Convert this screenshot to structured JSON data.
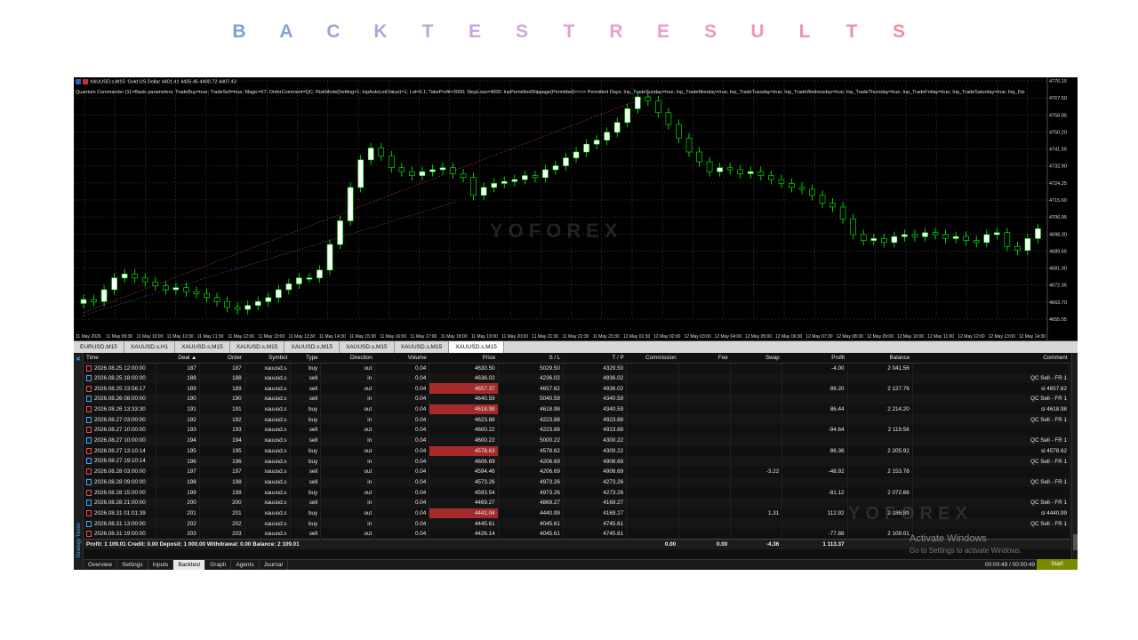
{
  "title_letters": [
    "B",
    "A",
    "C",
    "K",
    "T",
    "E",
    "S",
    "T",
    "R",
    "E",
    "S",
    "U",
    "L",
    "T",
    "S"
  ],
  "title_colors": [
    "#7f9fd8",
    "#8aa3da",
    "#98a6dc",
    "#a7a9de",
    "#b6a9dd",
    "#c4a8dc",
    "#d1a6da",
    "#dca4d6",
    "#e4a1cf",
    "#e99dc6",
    "#ec99bd",
    "#ee96b4",
    "#ef93ab",
    "#ef90a3",
    "#ef8d9b"
  ],
  "chart": {
    "header": "XAUUSD.s,M15:  Gold US Dollar  4401.41 4405.45 4400.72 4407.43",
    "params": "Quantum Commander [11=Basic parameters; TradeBuy=true; TradeSell=true; Magic=67; OrderComment=QC; RiskMode[Setting=1; InpAutoLot(Value)=1; Lot=0.1; TakeProfit=3000; StopLoss=4000; InpPermittedSlippage(Permitted)=>>> Permitted Days; Inp_TradeSunday=true; Inp_TradeMonday=true; Inp_TradeTuesday=true; Inp_TradeWednesday=true; Inp_TradeThursday=true; Inp_TradeFriday=true; Inp_TradeSaturday=true; Inp_Dis",
    "watermark": "YOFOREX",
    "price_labels": [
      "4776.15",
      "4767.50",
      "4758.85",
      "4750.20",
      "4741.55",
      "4732.90",
      "4724.25",
      "4715.60",
      "4706.95",
      "4698.30",
      "4689.65",
      "4681.00",
      "4672.35",
      "4663.70",
      "4655.05"
    ],
    "time_labels": [
      "11 May 2026",
      "11 May 09:30",
      "11 May 10:00",
      "11 May 10:30",
      "11 May 11:30",
      "11 May 12:00",
      "11 May 13:00",
      "11 May 13:30",
      "11 May 14:30",
      "11 May 15:30",
      "11 May 16:00",
      "11 May 17:00",
      "11 May 18:00",
      "11 May 19:00",
      "11 May 20:00",
      "11 May 21:30",
      "11 May 22:30",
      "11 May 23:30",
      "12 May 01:30",
      "12 May 02:00",
      "12 May 03:00",
      "12 May 04:00",
      "12 May 05:00",
      "12 May 06:30",
      "12 May 07:30",
      "12 May 08:30",
      "12 May 09:00",
      "12 May 10:00",
      "12 May 11:00",
      "12 May 12:00",
      "12 May 13:00",
      "12 May 14:30"
    ]
  },
  "symbol_tabs": [
    "EURUSD,M15",
    "XAUUSD.s,H1",
    "XAUUSD.s,M15",
    "XAUUSD.s,M15",
    "XAUUSD.s,M15",
    "XAUUSD.s,M15",
    "XAUUSD.s,M15",
    "XAUUSD.s,M15"
  ],
  "columns": [
    "Time",
    "Deal",
    "Order",
    "Symbol",
    "Type",
    "Direction",
    "Volume",
    "Price",
    "S / L",
    "T / P",
    "Commission",
    "Fee",
    "Swap",
    "Profit",
    "Balance",
    "Comment"
  ],
  "deals": [
    {
      "time": "2026.08.25 12:00:00",
      "deal": "187",
      "order": "187",
      "symbol": "xauusd.s",
      "type": "buy",
      "dir": "out",
      "vol": "0.04",
      "price": "4630.50",
      "sl": "5029.50",
      "tp": "4329.50",
      "swap": "",
      "profit": "-4.00",
      "balance": "2 041.56",
      "comment": "",
      "hl": false
    },
    {
      "time": "2026.08.25 18:00:00",
      "deal": "188",
      "order": "188",
      "symbol": "xauusd.s",
      "type": "sell",
      "dir": "in",
      "vol": "0.04",
      "price": "4636.02",
      "sl": "4236.02",
      "tp": "4936.02",
      "swap": "",
      "profit": "",
      "balance": "",
      "comment": "QC Sell - FR 1",
      "hl": false
    },
    {
      "time": "2026.08.25 23:56:17",
      "deal": "189",
      "order": "189",
      "symbol": "xauusd.s",
      "type": "sell",
      "dir": "out",
      "vol": "0.04",
      "price": "4657.37",
      "sl": "4657.62",
      "tp": "4936.02",
      "swap": "",
      "profit": "86.20",
      "balance": "2 127.76",
      "comment": "sl 4657.62",
      "hl": true
    },
    {
      "time": "2026.08.26 08:00:00",
      "deal": "190",
      "order": "190",
      "symbol": "xauusd.s",
      "type": "sell",
      "dir": "in",
      "vol": "0.04",
      "price": "4640.59",
      "sl": "5040.59",
      "tp": "4340.59",
      "swap": "",
      "profit": "",
      "balance": "",
      "comment": "QC Sell - FR 1",
      "hl": false
    },
    {
      "time": "2026.08.26 13:33:30",
      "deal": "191",
      "order": "191",
      "symbol": "xauusd.s",
      "type": "buy",
      "dir": "out",
      "vol": "0.04",
      "price": "4618.98",
      "sl": "4618.98",
      "tp": "4340.59",
      "swap": "",
      "profit": "86.44",
      "balance": "2 214.20",
      "comment": "sl 4618.98",
      "hl": true
    },
    {
      "time": "2026.08.27 03:00:00",
      "deal": "192",
      "order": "192",
      "symbol": "xauusd.s",
      "type": "buy",
      "dir": "in",
      "vol": "0.04",
      "price": "4623.88",
      "sl": "4223.88",
      "tp": "4923.88",
      "swap": "",
      "profit": "",
      "balance": "",
      "comment": "QC Sell - FR 1",
      "hl": false
    },
    {
      "time": "2026.08.27 10:00:00",
      "deal": "193",
      "order": "193",
      "symbol": "xauusd.s",
      "type": "sell",
      "dir": "out",
      "vol": "0.04",
      "price": "4600.22",
      "sl": "4223.88",
      "tp": "4923.88",
      "swap": "",
      "profit": "-94.64",
      "balance": "2 119.56",
      "comment": "",
      "hl": false
    },
    {
      "time": "2026.08.27 10:00:00",
      "deal": "194",
      "order": "194",
      "symbol": "xauusd.s",
      "type": "sell",
      "dir": "in",
      "vol": "0.04",
      "price": "4600.22",
      "sl": "5000.22",
      "tp": "4300.22",
      "swap": "",
      "profit": "",
      "balance": "",
      "comment": "QC Sell - FR 1",
      "hl": false
    },
    {
      "time": "2026.08.27 13:10:14",
      "deal": "195",
      "order": "195",
      "symbol": "xauusd.s",
      "type": "buy",
      "dir": "out",
      "vol": "0.04",
      "price": "4578.63",
      "sl": "4578.62",
      "tp": "4300.22",
      "swap": "",
      "profit": "86.36",
      "balance": "2 205.92",
      "comment": "sl 4578.62",
      "hl": true
    },
    {
      "time": "2026.08.27 19:10:14",
      "deal": "196",
      "order": "196",
      "symbol": "xauusd.s",
      "type": "buy",
      "dir": "in",
      "vol": "0.04",
      "price": "4606.69",
      "sl": "4206.69",
      "tp": "4906.69",
      "swap": "",
      "profit": "",
      "balance": "",
      "comment": "QC Sell - FR 1",
      "hl": false
    },
    {
      "time": "2026.08.28 03:00:00",
      "deal": "197",
      "order": "197",
      "symbol": "xauusd.s",
      "type": "sell",
      "dir": "out",
      "vol": "0.04",
      "price": "4594.46",
      "sl": "4206.69",
      "tp": "4906.69",
      "swap": "-3.22",
      "profit": "-48.92",
      "balance": "2 153.78",
      "comment": "",
      "hl": false
    },
    {
      "time": "2026.08.28 09:00:00",
      "deal": "198",
      "order": "198",
      "symbol": "xauusd.s",
      "type": "sell",
      "dir": "in",
      "vol": "0.04",
      "price": "4573.26",
      "sl": "4973.26",
      "tp": "4273.26",
      "swap": "",
      "profit": "",
      "balance": "",
      "comment": "QC Sell - FR 1",
      "hl": false
    },
    {
      "time": "2026.08.28 15:00:00",
      "deal": "199",
      "order": "199",
      "symbol": "xauusd.s",
      "type": "buy",
      "dir": "out",
      "vol": "0.04",
      "price": "4593.54",
      "sl": "4973.26",
      "tp": "4273.26",
      "swap": "",
      "profit": "-81.12",
      "balance": "2 072.66",
      "comment": "",
      "hl": false
    },
    {
      "time": "2026.08.28 21:00:00",
      "deal": "200",
      "order": "200",
      "symbol": "xauusd.s",
      "type": "sell",
      "dir": "in",
      "vol": "0.04",
      "price": "4469.27",
      "sl": "4869.27",
      "tp": "4169.27",
      "swap": "",
      "profit": "",
      "balance": "",
      "comment": "QC Sell - FR 1",
      "hl": false
    },
    {
      "time": "2026.08.31 01:01:39",
      "deal": "201",
      "order": "201",
      "symbol": "xauusd.s",
      "type": "buy",
      "dir": "out",
      "vol": "0.04",
      "price": "4441.04",
      "sl": "4440.99",
      "tp": "4169.27",
      "swap": "1.31",
      "profit": "112.92",
      "balance": "2 186.89",
      "comment": "sl 4440.99",
      "hl": true
    },
    {
      "time": "2026.08.31 13:00:00",
      "deal": "202",
      "order": "202",
      "symbol": "xauusd.s",
      "type": "buy",
      "dir": "in",
      "vol": "0.04",
      "price": "4445.61",
      "sl": "4045.61",
      "tp": "4745.61",
      "swap": "",
      "profit": "",
      "balance": "",
      "comment": "QC Sell - FR 1",
      "hl": false
    },
    {
      "time": "2026.08.31 19:00:00",
      "deal": "203",
      "order": "203",
      "symbol": "xauusd.s",
      "type": "sell",
      "dir": "out",
      "vol": "0.04",
      "price": "4426.14",
      "sl": "4045.61",
      "tp": "4745.61",
      "swap": "",
      "profit": "-77.88",
      "balance": "2 109.01",
      "comment": "",
      "hl": false
    }
  ],
  "totals": {
    "summary": "Profit: 1 109.01   Credit: 0.00   Deposit: 1 000.00   Withdrawal: 0.00   Balance: 2 109.01",
    "commission": "0.00",
    "fee": "0.00",
    "swap": "-4.36",
    "profit": "1 113.37"
  },
  "bottom_tabs": [
    "Overview",
    "Settings",
    "Inputs",
    "Backtest",
    "Graph",
    "Agents",
    "Journal"
  ],
  "active_bottom_tab": "Backtest",
  "timer": "00:00:49 / 00:00:49",
  "start_label": "Start",
  "side_label": "Strategy Tester",
  "activate_title": "Activate Windows",
  "activate_sub": "Go to Settings to activate Windows.",
  "colors": {
    "bull": "#ffffff",
    "bear": "#000000",
    "wick": "#00ff00",
    "highlight": "#a52a2a",
    "start": "#7a8a00"
  }
}
